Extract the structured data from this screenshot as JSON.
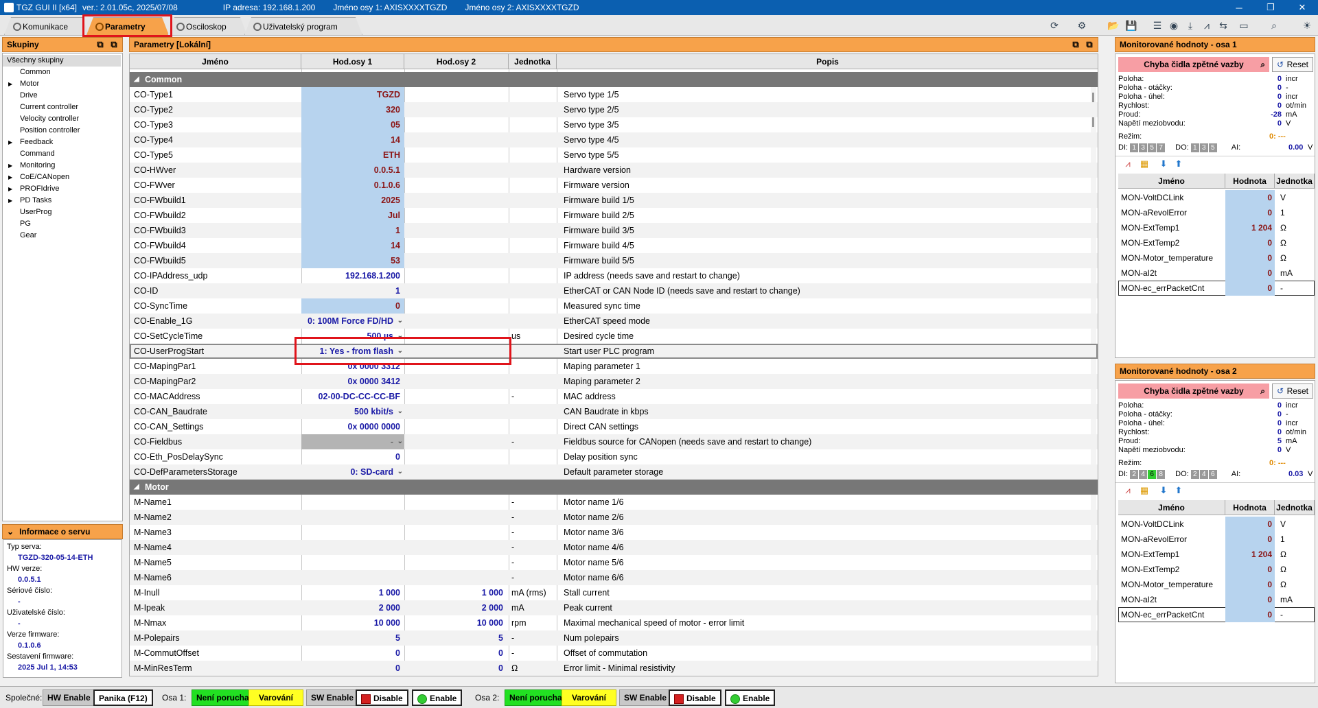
{
  "titlebar": {
    "app": "TGZ GUI II [x64]",
    "version": "ver.: 2.01.05c,  2025/07/08",
    "ip": "IP adresa: 192.168.1.200",
    "axis1": "Jméno osy 1: AXISXXXXTGZD",
    "axis2": "Jméno osy 2: AXISXXXXTGZD",
    "minimize": "─",
    "restore": "❐",
    "close": "✕"
  },
  "tabs": [
    {
      "label": "Komunikace"
    },
    {
      "label": "Parametry"
    },
    {
      "label": "Osciloskop"
    },
    {
      "label": "Uživatelský program"
    }
  ],
  "left": {
    "header": "Skupiny",
    "groups": [
      "Všechny skupiny",
      "Common",
      "Motor",
      "Drive",
      "Current controller",
      "Velocity controller",
      "Position controller",
      "Feedback",
      "Command",
      "Monitoring",
      "CoE/CANopen",
      "PROFIdrive",
      "PD Tasks",
      "UserProg",
      "PG",
      "Gear"
    ],
    "info_header": "Informace o servu",
    "info": [
      {
        "k": "Typ serva:",
        "v": "TGZD-320-05-14-ETH"
      },
      {
        "k": "HW verze:",
        "v": "0.0.5.1"
      },
      {
        "k": "Sériové číslo:",
        "v": "-"
      },
      {
        "k": "Uživatelské číslo:",
        "v": "-"
      },
      {
        "k": "Verze firmware:",
        "v": "0.1.0.6"
      },
      {
        "k": "Sestavení firmware:",
        "v": "2025 Jul  1, 14:53"
      }
    ]
  },
  "params": {
    "header": "Parametry  [Lokální]",
    "columns": [
      "Jméno",
      "Hod.osy 1",
      "Hod.osy 2",
      "Jednotka",
      "Popis"
    ],
    "sections": [
      {
        "title": "Common",
        "rows": [
          [
            "CO-Type1",
            "TGZD",
            "",
            "",
            "Servo type 1/5"
          ],
          [
            "CO-Type2",
            "320",
            "",
            "",
            "Servo type 2/5"
          ],
          [
            "CO-Type3",
            "05",
            "",
            "",
            "Servo type 3/5"
          ],
          [
            "CO-Type4",
            "14",
            "",
            "",
            "Servo type 4/5"
          ],
          [
            "CO-Type5",
            "ETH",
            "",
            "",
            "Servo type 5/5"
          ],
          [
            "CO-HWver",
            "0.0.5.1",
            "",
            "",
            "Hardware version"
          ],
          [
            "CO-FWver",
            "0.1.0.6",
            "",
            "",
            "Firmware version"
          ],
          [
            "CO-FWbuild1",
            "2025",
            "",
            "",
            "Firmware build 1/5"
          ],
          [
            "CO-FWbuild2",
            "Jul",
            "",
            "",
            "Firmware build 2/5"
          ],
          [
            "CO-FWbuild3",
            "1",
            "",
            "",
            "Firmware build 3/5"
          ],
          [
            "CO-FWbuild4",
            "14",
            "",
            "",
            "Firmware build 4/5"
          ],
          [
            "CO-FWbuild5",
            "53",
            "",
            "",
            "Firmware build 5/5"
          ],
          [
            "CO-IPAddress_udp",
            "192.168.1.200",
            "",
            "",
            "IP address (needs save and restart to change)"
          ],
          [
            "CO-ID",
            "1",
            "",
            "",
            "EtherCAT or CAN Node ID (needs save and restart to change)"
          ],
          [
            "CO-SyncTime",
            "0",
            "",
            "",
            "Measured sync time"
          ],
          [
            "CO-Enable_1G",
            "0: 100M Force FD/HD",
            "",
            "",
            "EtherCAT speed mode"
          ],
          [
            "CO-SetCycleTime",
            "500 µs",
            "",
            "us",
            "Desired cycle time"
          ],
          [
            "CO-UserProgStart",
            "1: Yes - from flash",
            "",
            "",
            "Start user PLC program"
          ],
          [
            "CO-MapingPar1",
            "0x 0000 3312",
            "",
            "",
            "Maping parameter 1"
          ],
          [
            "CO-MapingPar2",
            "0x 0000 3412",
            "",
            "",
            "Maping parameter 2"
          ],
          [
            "CO-MACAddress",
            "02-00-DC-CC-CC-BF",
            "",
            "-",
            "MAC address"
          ],
          [
            "CO-CAN_Baudrate",
            "500 kbit/s",
            "",
            "",
            "CAN Baudrate in kbps"
          ],
          [
            "CO-CAN_Settings",
            "0x 0000 0000",
            "",
            "",
            "Direct CAN settings"
          ],
          [
            "CO-Fieldbus",
            "-",
            "",
            "-",
            "Fieldbus source for CANopen (needs save and restart to change)"
          ],
          [
            "CO-Eth_PosDelaySync",
            "0",
            "",
            "",
            "Delay position sync"
          ],
          [
            "CO-DefParametersStorage",
            "0: SD-card",
            "",
            "",
            "Default parameter storage"
          ]
        ]
      },
      {
        "title": "Motor",
        "rows": [
          [
            "M-Name1",
            "",
            "",
            "-",
            "Motor name 1/6"
          ],
          [
            "M-Name2",
            "",
            "",
            "-",
            "Motor name 2/6"
          ],
          [
            "M-Name3",
            "",
            "",
            "-",
            "Motor name 3/6"
          ],
          [
            "M-Name4",
            "",
            "",
            "-",
            "Motor name 4/6"
          ],
          [
            "M-Name5",
            "",
            "",
            "-",
            "Motor name 5/6"
          ],
          [
            "M-Name6",
            "",
            "",
            "-",
            "Motor name 6/6"
          ],
          [
            "M-Inull",
            "1 000",
            "1 000",
            "mA (rms)",
            "Stall current"
          ],
          [
            "M-Ipeak",
            "2 000",
            "2 000",
            "mA",
            "Peak current"
          ],
          [
            "M-Nmax",
            "10 000",
            "10 000",
            "rpm",
            "Maximal mechanical speed of motor - error limit"
          ],
          [
            "M-Polepairs",
            "5",
            "5",
            "-",
            "Num polepairs"
          ],
          [
            "M-CommutOffset",
            "0",
            "0",
            "-",
            "Offset of commutation"
          ],
          [
            "M-MinResTerm",
            "0",
            "0",
            "Ω",
            "Error limit - Minimal resistivity"
          ]
        ]
      }
    ]
  },
  "monitors": [
    {
      "header": "Monitorované hodnoty - osa 1",
      "error": "Chyba čidla zpětné vazby",
      "reset": "Reset",
      "lines": [
        {
          "k": "Poloha:",
          "v": "0",
          "u": "incr"
        },
        {
          "k": "Poloha - otáčky:",
          "v": "0",
          "u": "-"
        },
        {
          "k": "Poloha - úhel:",
          "v": "0",
          "u": "incr"
        },
        {
          "k": "Rychlost:",
          "v": "0",
          "u": "ot/min"
        },
        {
          "k": "Proud:",
          "v": "-28",
          "u": "mA"
        },
        {
          "k": "Napětí meziobvodu:",
          "v": "0",
          "u": "V"
        }
      ],
      "mode_label": "Režim:",
      "mode_value": "0: ---",
      "di_label": "DI:",
      "di": [
        "1",
        "3",
        "5",
        "7"
      ],
      "di_on": [],
      "do_label": "DO:",
      "do": [
        "1",
        "3",
        "5"
      ],
      "ai_label": "AI:",
      "ai_value": "0.00",
      "ai_unit": "V",
      "table_cols": [
        "Jméno",
        "Hodnota",
        "Jednotka"
      ],
      "rows": [
        [
          "MON-VoltDCLink",
          "0",
          "V"
        ],
        [
          "MON-aRevolError",
          "0",
          "1"
        ],
        [
          "MON-ExtTemp1",
          "1 204",
          "Ω"
        ],
        [
          "MON-ExtTemp2",
          "0",
          "Ω"
        ],
        [
          "MON-Motor_temperature",
          "0",
          "Ω"
        ],
        [
          "MON-aI2t",
          "0",
          "mA"
        ],
        [
          "MON-ec_errPacketCnt",
          "0",
          "-"
        ]
      ]
    },
    {
      "header": "Monitorované hodnoty - osa 2",
      "error": "Chyba čidla zpětné vazby",
      "reset": "Reset",
      "lines": [
        {
          "k": "Poloha:",
          "v": "0",
          "u": "incr"
        },
        {
          "k": "Poloha - otáčky:",
          "v": "0",
          "u": "-"
        },
        {
          "k": "Poloha - úhel:",
          "v": "0",
          "u": "incr"
        },
        {
          "k": "Rychlost:",
          "v": "0",
          "u": "ot/min"
        },
        {
          "k": "Proud:",
          "v": "5",
          "u": "mA"
        },
        {
          "k": "Napětí meziobvodu:",
          "v": "0",
          "u": "V"
        }
      ],
      "mode_label": "Režim:",
      "mode_value": "0: ---",
      "di_label": "DI:",
      "di": [
        "2",
        "4",
        "6",
        "8"
      ],
      "di_on": [
        "6"
      ],
      "do_label": "DO:",
      "do": [
        "2",
        "4",
        "6"
      ],
      "ai_label": "AI:",
      "ai_value": "0.03",
      "ai_unit": "V",
      "table_cols": [
        "Jméno",
        "Hodnota",
        "Jednotka"
      ],
      "rows": [
        [
          "MON-VoltDCLink",
          "0",
          "V"
        ],
        [
          "MON-aRevolError",
          "0",
          "1"
        ],
        [
          "MON-ExtTemp1",
          "1 204",
          "Ω"
        ],
        [
          "MON-ExtTemp2",
          "0",
          "Ω"
        ],
        [
          "MON-Motor_temperature",
          "0",
          "Ω"
        ],
        [
          "MON-aI2t",
          "0",
          "mA"
        ],
        [
          "MON-ec_errPacketCnt",
          "0",
          "-"
        ]
      ]
    }
  ],
  "status": {
    "common_label": "Společné:",
    "hw_enable": "HW Enable",
    "panic": "Panika (F12)",
    "axis1_label": "Osa 1:",
    "axis2_label": "Osa 2:",
    "no_fault": "Není porucha",
    "warning": "Varování",
    "sw_enable": "SW Enable",
    "disable": "Disable",
    "enable": "Enable"
  },
  "colors": {
    "accent": "#f7a24a",
    "title": "#0b5fb0",
    "value": "#1a1aa6",
    "readonly": "#b7d3ee",
    "highlight": "#e0141b"
  }
}
